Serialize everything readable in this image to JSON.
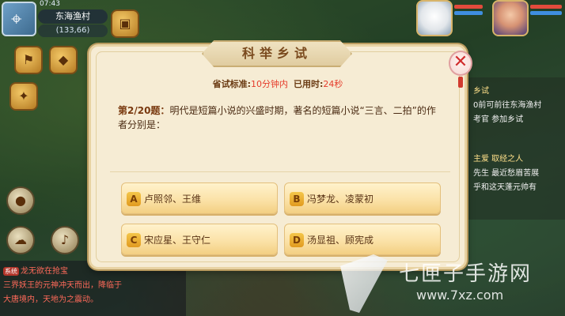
{
  "status": {
    "time": "07:43",
    "location": "东海渔村",
    "coords": "(133,66)"
  },
  "modal": {
    "title": "科举乡试",
    "close_label": "✕",
    "standard_label": "省试标准:",
    "standard_value": "10分钟内",
    "elapsed_label": "已用时:",
    "elapsed_value": "24秒",
    "question_no": "第2/20题：",
    "question_text": "明代是短篇小说的兴盛时期，著名的短篇小说“三言、二拍”的作者分别是：",
    "options": [
      {
        "key": "A",
        "text": "卢照邻、王维"
      },
      {
        "key": "B",
        "text": "冯梦龙、凌蒙初"
      },
      {
        "key": "C",
        "text": "宋应星、王守仁"
      },
      {
        "key": "D",
        "text": "汤显祖、顾宪成"
      }
    ]
  },
  "side_panel": {
    "lines": [
      {
        "text": "乡试",
        "color": "#ffe08a"
      },
      {
        "text": "0前可前往东海渔村",
        "color": "#f0f0f0"
      },
      {
        "text": "考官 参加乡试",
        "color": "#f0f0f0"
      },
      {
        "text": "主爱 取经之人",
        "color": "#ffe08a"
      },
      {
        "text": "先生 最近愁眉苦展",
        "color": "#f0f0f0"
      },
      {
        "text": "乎和这天蓬元帅有",
        "color": "#f0f0f0"
      }
    ]
  },
  "chat": {
    "system_tag": "系统",
    "lines": [
      {
        "text": "龙无欲在抢宝",
        "color": "#ff6a5a"
      },
      {
        "text": "三界妖王的元神冲天而出，降临于",
        "color": "#ff6a5a"
      },
      {
        "text": "大唐境内，天地为之震动。",
        "color": "#ff6a5a"
      }
    ]
  },
  "watermark": {
    "name": "七匣子手游网",
    "url": "www.7xz.com"
  },
  "colors": {
    "accent_red": "#e53b2a",
    "panel_bg": "#f6ecd4",
    "option_gold": "#fbe2a8"
  }
}
